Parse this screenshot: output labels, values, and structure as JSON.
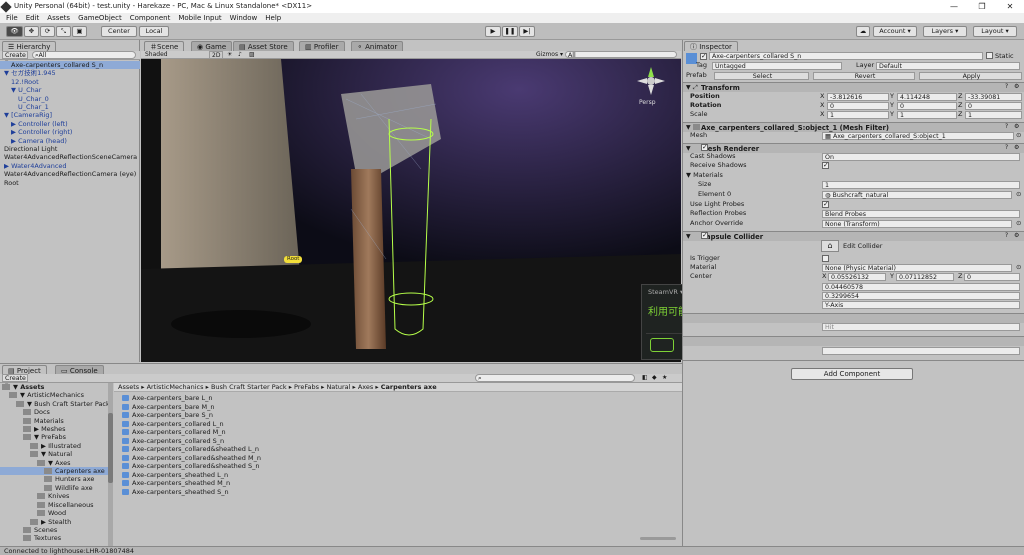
{
  "window": {
    "title": "Unity Personal (64bit) - test.unity - Harekaze - PC, Mac & Linux Standalone* <DX11>",
    "controls": [
      "—",
      "❐",
      "✕"
    ]
  },
  "menu": [
    "File",
    "Edit",
    "Assets",
    "GameObject",
    "Component",
    "Mobile Input",
    "Window",
    "Help"
  ],
  "toolbar": {
    "center": "Center",
    "local": "Local",
    "account": "Account",
    "layers": "Layers",
    "layout": "Layout"
  },
  "hierarchy": {
    "tab": "Hierarchy",
    "create": "Create",
    "search": "All",
    "items": [
      {
        "label": "Axe-carpenters_collared S_n",
        "indent": 1,
        "blue": false,
        "sel": true
      },
      {
        "label": "▼ セガ技術1.945",
        "indent": 0,
        "blue": true
      },
      {
        "label": "12.!Root",
        "indent": 1,
        "blue": true
      },
      {
        "label": "▼ U_Char",
        "indent": 1,
        "blue": true
      },
      {
        "label": "U_Char_0",
        "indent": 2,
        "blue": true
      },
      {
        "label": "U_Char_1",
        "indent": 2,
        "blue": true
      },
      {
        "label": "▼ [CameraRig]",
        "indent": 0,
        "blue": true
      },
      {
        "label": "▶ Controller (left)",
        "indent": 1,
        "blue": true
      },
      {
        "label": "▶ Controller (right)",
        "indent": 1,
        "blue": true
      },
      {
        "label": "▶ Camera (head)",
        "indent": 1,
        "blue": true
      },
      {
        "label": "Directional Light",
        "indent": 0,
        "blue": false
      },
      {
        "label": "Water4AdvancedReflectionSceneCamera",
        "indent": 0,
        "blue": false
      },
      {
        "label": "▶ Water4Advanced",
        "indent": 0,
        "blue": true
      },
      {
        "label": "Water4AdvancedReflectionCamera (eye)",
        "indent": 0,
        "blue": false
      },
      {
        "label": "Root",
        "indent": 0,
        "blue": false
      }
    ]
  },
  "scene": {
    "tabs": [
      "Scene",
      "Game",
      "Asset Store",
      "Profiler",
      "Animator"
    ],
    "shading": "Shaded",
    "mode2d": "2D",
    "gizmos": "Gizmos",
    "search": "All",
    "persp": "Persp",
    "root_label": "Root"
  },
  "steamvr": {
    "title": "SteamVR",
    "status": "利用可能"
  },
  "inspector": {
    "tab": "Inspector",
    "name": "Axe-carpenters_collared S_n",
    "static": "Static",
    "tag_label": "Tag",
    "tag": "Untagged",
    "layer_label": "Layer",
    "layer": "Default",
    "prefab_label": "Prefab",
    "select": "Select",
    "revert": "Revert",
    "apply": "Apply",
    "transform": {
      "title": "Transform",
      "position": "Position",
      "rotation": "Rotation",
      "scale": "Scale",
      "px": "-3.812616",
      "py": "4.114248",
      "pz": "-33.39081",
      "rx": "0",
      "ry": "0",
      "rz": "0",
      "sx": "1",
      "sy": "1",
      "sz": "1"
    },
    "meshfilter": {
      "title": "Axe_carpenters_collared_S:object_1 (Mesh Filter)",
      "mesh_label": "Mesh",
      "mesh": "Axe_carpenters_collared_S:object_1"
    },
    "renderer": {
      "title": "Mesh Renderer",
      "cast": "Cast Shadows",
      "cast_val": "On",
      "receive": "Receive Shadows",
      "materials": "Materials",
      "size": "Size",
      "size_val": "1",
      "elem": "Element 0",
      "elem_val": "Bushcraft_natural",
      "light": "Use Light Probes",
      "refl": "Reflection Probes",
      "refl_val": "Blend Probes",
      "anchor": "Anchor Override",
      "anchor_val": "None (Transform)"
    },
    "collider": {
      "title": "Capsule Collider",
      "edit": "Edit Collider",
      "trigger": "Is Trigger",
      "material": "Material",
      "material_val": "None (Physic Material)",
      "center": "Center",
      "cx": "0.05526132",
      "cy": "0.07112852",
      "cz": "0",
      "radius_val": "0.04460578",
      "height_val": "0.3299654",
      "dir_val": "Y-Axis",
      "hit": "Hit"
    },
    "add_component": "Add Component"
  },
  "project": {
    "tabs": [
      "Project",
      "Console"
    ],
    "create": "Create",
    "breadcrumb": [
      "Assets",
      "ArtisticMechanics",
      "Bush Craft Starter Pack",
      "PreFabs",
      "Natural",
      "Axes",
      "Carpenters axe"
    ],
    "tree": [
      {
        "label": "▼ Assets",
        "indent": 0,
        "bold": true
      },
      {
        "label": "▼ ArtisticMechanics",
        "indent": 1
      },
      {
        "label": "▼ Bush Craft Starter Pack",
        "indent": 2
      },
      {
        "label": "Docs",
        "indent": 3
      },
      {
        "label": "Materials",
        "indent": 3
      },
      {
        "label": "▶ Meshes",
        "indent": 3
      },
      {
        "label": "▼ PreFabs",
        "indent": 3
      },
      {
        "label": "▶ Illustrated",
        "indent": 4
      },
      {
        "label": "▼ Natural",
        "indent": 4
      },
      {
        "label": "▼ Axes",
        "indent": 5
      },
      {
        "label": "Carpenters axe",
        "indent": 6,
        "sel": true
      },
      {
        "label": "Hunters axe",
        "indent": 6
      },
      {
        "label": "Wildlife axe",
        "indent": 6
      },
      {
        "label": "Knives",
        "indent": 5
      },
      {
        "label": "Miscellaneous",
        "indent": 5
      },
      {
        "label": "Wood",
        "indent": 5
      },
      {
        "label": "▶ Stealth",
        "indent": 4
      },
      {
        "label": "Scenes",
        "indent": 3
      },
      {
        "label": "Textures",
        "indent": 3
      }
    ],
    "files": [
      "Axe-carpenters_bare L_n",
      "Axe-carpenters_bare M_n",
      "Axe-carpenters_bare S_n",
      "Axe-carpenters_collared L_n",
      "Axe-carpenters_collared M_n",
      "Axe-carpenters_collared S_n",
      "Axe-carpenters_collared&sheathed L_n",
      "Axe-carpenters_collared&sheathed M_n",
      "Axe-carpenters_collared&sheathed S_n",
      "Axe-carpenters_sheathed L_n",
      "Axe-carpenters_sheathed M_n",
      "Axe-carpenters_sheathed S_n"
    ]
  },
  "status": "Connected to lighthouse:LHR-01807484"
}
